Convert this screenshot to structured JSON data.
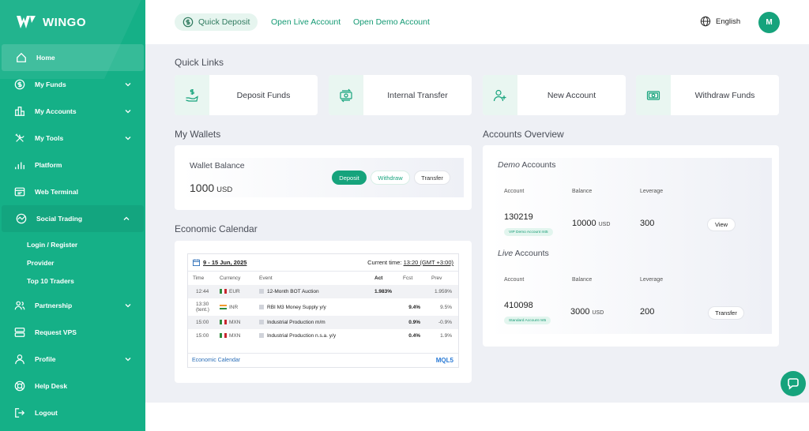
{
  "brand": {
    "name": "WINGO"
  },
  "sidebar": {
    "items": [
      {
        "label": "Home",
        "icon": "home-icon"
      },
      {
        "label": "My Funds",
        "icon": "dollar-icon"
      },
      {
        "label": "My Accounts",
        "icon": "accounts-icon"
      },
      {
        "label": "My Tools",
        "icon": "tools-icon"
      },
      {
        "label": "Platform",
        "icon": "chart-icon"
      },
      {
        "label": "Web Terminal",
        "icon": "terminal-icon"
      },
      {
        "label": "Social Trading",
        "icon": "social-icon"
      },
      {
        "label": "Partnership",
        "icon": "partnership-icon"
      },
      {
        "label": "Request VPS",
        "icon": "server-icon"
      },
      {
        "label": "Profile",
        "icon": "user-icon"
      },
      {
        "label": "Help Desk",
        "icon": "lifebuoy-icon"
      },
      {
        "label": "Logout",
        "icon": "logout-icon"
      }
    ],
    "social_sub": [
      "Login / Register",
      "Provider",
      "Top 10 Traders"
    ]
  },
  "topbar": {
    "quick_deposit": "Quick Deposit",
    "open_live": "Open Live Account",
    "open_demo": "Open Demo Account",
    "language": "English",
    "avatar_initial": "M"
  },
  "quick_links": {
    "title": "Quick Links",
    "items": [
      "Deposit Funds",
      "Internal Transfer",
      "New Account",
      "Withdraw Funds"
    ]
  },
  "wallets": {
    "title": "My Wallets",
    "balance_label": "Wallet Balance",
    "amount": "1000",
    "currency": "USD",
    "deposit": "Deposit",
    "withdraw": "Withdraw",
    "transfer": "Transfer"
  },
  "calendar": {
    "title": "Economic Calendar",
    "date_range": "9 - 15 Jun, 2025",
    "current_time_label": "Current time:",
    "current_time": "13:20 (GMT +3:00)",
    "headers": [
      "Time",
      "Currency",
      "Event",
      "Act",
      "Fcst",
      "Prev"
    ],
    "rows": [
      {
        "time": "12:44",
        "currency": "EUR",
        "event": "12-Month BOT Auction",
        "act": "1.983%",
        "fcst": "",
        "prev": "1.959%"
      },
      {
        "time": "13:30 (tent.)",
        "currency": "INR",
        "event": "RBI M3 Money Supply y/y",
        "act": "",
        "fcst": "9.4%",
        "prev": "9.5%"
      },
      {
        "time": "15:00",
        "currency": "MXN",
        "event": "Industrial Production m/m",
        "act": "",
        "fcst": "0.9%",
        "prev": "-0.9%"
      },
      {
        "time": "15:00",
        "currency": "MXN",
        "event": "Industrial Production n.s.a. y/y",
        "act": "",
        "fcst": "0.4%",
        "prev": "1.9%"
      }
    ],
    "footer_link": "Economic Calendar",
    "footer_logo": "MQL5"
  },
  "accounts": {
    "title": "Accounts Overview",
    "demo_em": "Demo",
    "demo_rest": " Accounts",
    "live_em": "Live",
    "live_rest": " Accounts",
    "col_account": "Account",
    "col_balance": "Balance",
    "col_leverage": "Leverage",
    "demo": {
      "account": "130219",
      "tag": "VIP Demo Account mt5",
      "balance": "10000",
      "currency": "USD",
      "leverage": "300",
      "action": "View"
    },
    "live": {
      "account": "410098",
      "tag": "Standard Account mt5",
      "balance": "3000",
      "currency": "USD",
      "leverage": "200",
      "action": "Transfer"
    }
  },
  "colors": {
    "accent": "#16a37c",
    "sidebar": "#15b087",
    "background": "#eef0f5"
  }
}
